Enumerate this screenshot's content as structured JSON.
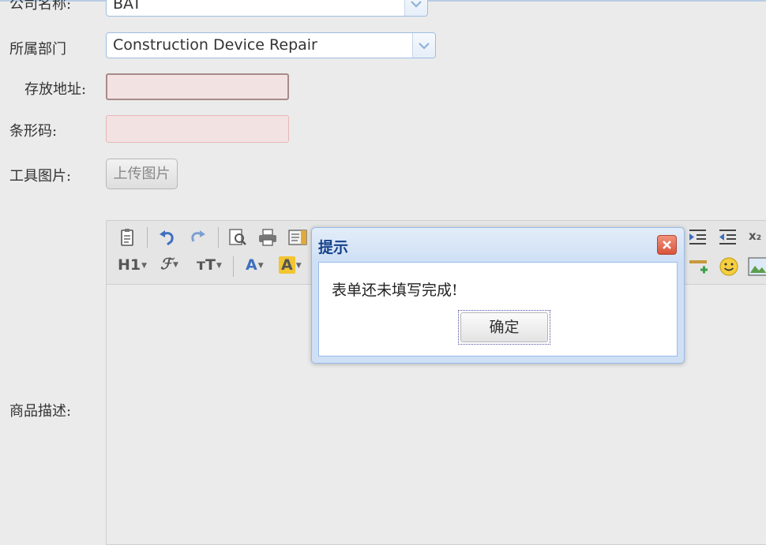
{
  "form": {
    "company": {
      "label": "公司名称:",
      "value": "BAT"
    },
    "department": {
      "label": "所属部门",
      "value": "Construction Device Repair"
    },
    "storage": {
      "label": "存放地址:",
      "value": ""
    },
    "barcode": {
      "label": "条形码:",
      "value": ""
    },
    "tool_image": {
      "label": "工具图片:",
      "upload_label": "上传图片"
    },
    "description": {
      "label": "商品描述:"
    }
  },
  "editor": {
    "heading_label": "H1",
    "font_label": "ℱ",
    "font_size_label": "ᴛT",
    "font_color_label": "A",
    "highlight_label": "A",
    "subscript_label": "x₂"
  },
  "dialog": {
    "title": "提示",
    "message": "表单还未填写完成!",
    "ok_label": "确定"
  },
  "colors": {
    "dialog_title": "#15428b",
    "field_invalid_bg": "#f3e2e2",
    "field_invalid_border_focus": "#a98a8a",
    "field_invalid_border": "#e8b8b8",
    "select_border": "#9fbde0"
  },
  "icons": [
    "paste-icon",
    "undo-icon",
    "redo-icon",
    "preview-icon",
    "print-icon",
    "template-icon",
    "indent-icon",
    "outdent-icon",
    "line-add-icon",
    "emoticon-icon",
    "image-icon",
    "close-icon",
    "chevron-down-icon"
  ]
}
